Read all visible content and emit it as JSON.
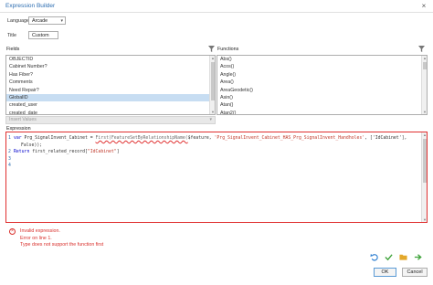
{
  "window": {
    "title": "Expression Builder",
    "close_glyph": "×"
  },
  "language": {
    "label": "Language",
    "value": "Arcade"
  },
  "title_field": {
    "label": "Title",
    "value": "Custom"
  },
  "fields": {
    "header": "Fields",
    "items": [
      "OBJECTID",
      "Cabinet Number?",
      "Has Fiber?",
      "Comments",
      "Need Repair?",
      "GlobalID",
      "created_user",
      "created_date"
    ],
    "selected_index": 5
  },
  "functions": {
    "header": "Functions",
    "items": [
      "Abs()",
      "Acos()",
      "Angle()",
      "Area()",
      "AreaGeodetic()",
      "Asin()",
      "Atan()",
      "Atan2()"
    ]
  },
  "insert_values": {
    "placeholder": "Insert Values"
  },
  "expression": {
    "header": "Expression",
    "lines": [
      {
        "num": "1",
        "kw": "var",
        "pre": " Prg_SignalInvent_Cabinet = ",
        "fn": "First(FeatureSetByRelationshipName(",
        "mid": "$feature, ",
        "str": "'Prg_SignalInvent_Cabinet_HAS_Prg_SignalInvent_Handholes'",
        "post": ", ['IdCabinet'],",
        "cont": "False));"
      },
      {
        "num": "2",
        "kw": "Return",
        "pre": " first_related_record[",
        "str": "\"IdCabinet\"",
        "post": "]"
      },
      {
        "num": "3"
      },
      {
        "num": "4"
      }
    ]
  },
  "errors": {
    "lines": [
      "Invalid expression.",
      "Error on line 1.",
      "Type does not support the function first"
    ]
  },
  "toolbar": {
    "icons": [
      "undo-icon",
      "check-icon",
      "folder-icon",
      "run-icon"
    ],
    "colors": {
      "undo": "#2f7fd1",
      "check": "#3ea33a",
      "folder": "#e3a82b",
      "run": "#3ea33a"
    }
  },
  "buttons": {
    "ok": "OK",
    "cancel": "Cancel"
  }
}
